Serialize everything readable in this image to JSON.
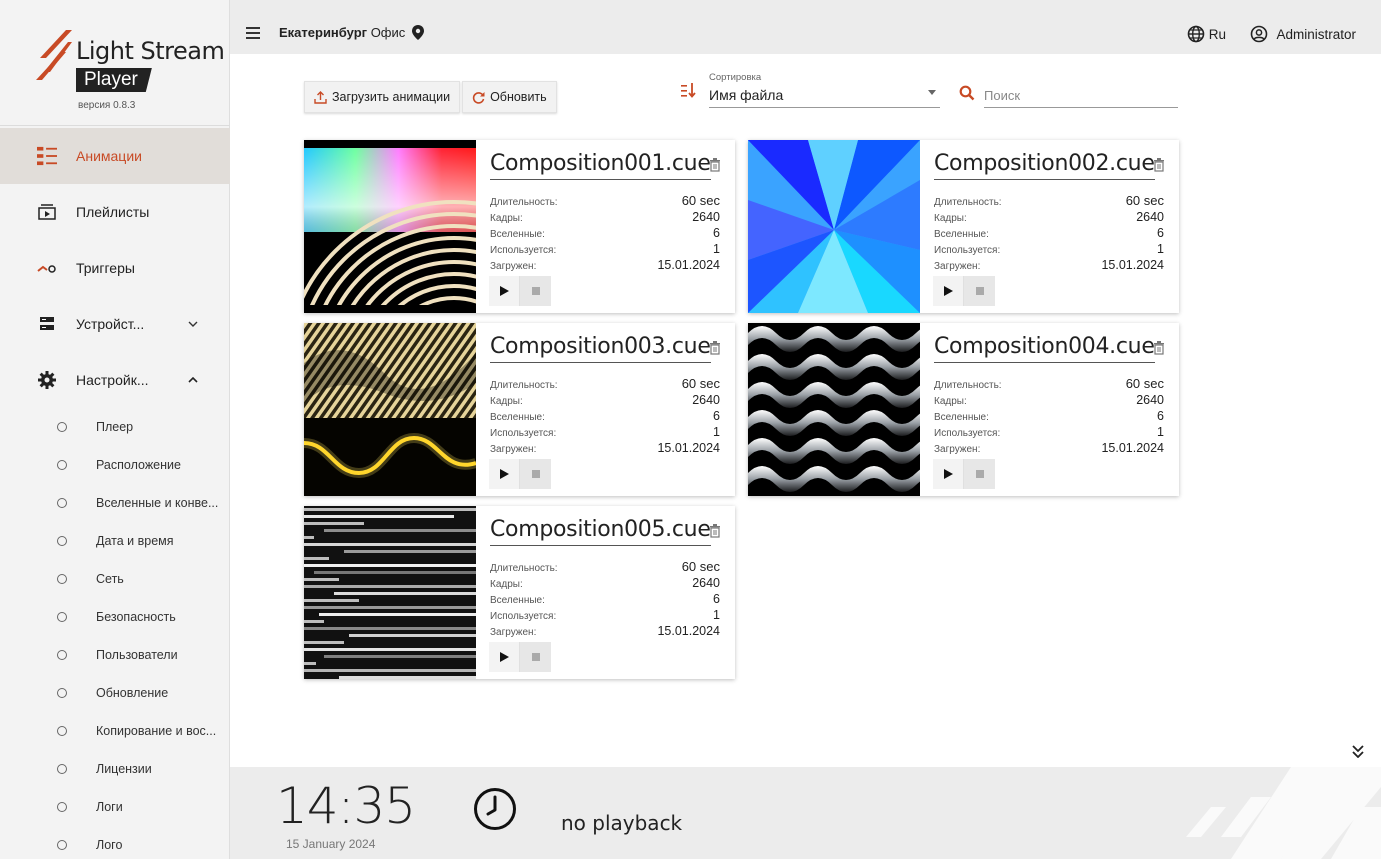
{
  "app": {
    "logo_line1": "Light Stream",
    "logo_line2": "Player",
    "version": "версия 0.8.3"
  },
  "header": {
    "city": "Екатеринбург",
    "place": "Офис",
    "language": "Ru",
    "user": "Administrator"
  },
  "sidebar": {
    "items": [
      {
        "label": "Анимации",
        "icon": "animations-icon",
        "active": true
      },
      {
        "label": "Плейлисты",
        "icon": "playlist-icon"
      },
      {
        "label": "Триггеры",
        "icon": "trigger-icon"
      },
      {
        "label": "Устройст...",
        "icon": "devices-icon",
        "chevron": "down"
      },
      {
        "label": "Настройк...",
        "icon": "gear-icon",
        "chevron": "up"
      }
    ],
    "settings_items": [
      "Плеер",
      "Расположение",
      "Вселенные и конве...",
      "Дата и время",
      "Сеть",
      "Безопасность",
      "Пользователи",
      "Обновление",
      "Копирование и вос...",
      "Лицензии",
      "Логи",
      "Лого"
    ]
  },
  "toolbar": {
    "upload_label": "Загрузить анимации",
    "refresh_label": "Обновить",
    "sort_label": "Сортировка",
    "sort_value": "Имя файла",
    "search_placeholder": "Поиск"
  },
  "card_labels": {
    "duration": "Длительность:",
    "frames": "Кадры:",
    "universes": "Вселенные:",
    "used": "Используется:",
    "uploaded": "Загружен:"
  },
  "animations": [
    {
      "name": "Composition001.cue",
      "duration": "60 sec",
      "frames": "2640",
      "universes": "6",
      "used": "1",
      "uploaded": "15.01.2024"
    },
    {
      "name": "Composition002.cue",
      "duration": "60 sec",
      "frames": "2640",
      "universes": "6",
      "used": "1",
      "uploaded": "15.01.2024"
    },
    {
      "name": "Composition003.cue",
      "duration": "60 sec",
      "frames": "2640",
      "universes": "6",
      "used": "1",
      "uploaded": "15.01.2024"
    },
    {
      "name": "Composition004.cue",
      "duration": "60 sec",
      "frames": "2640",
      "universes": "6",
      "used": "1",
      "uploaded": "15.01.2024"
    },
    {
      "name": "Composition005.cue",
      "duration": "60 sec",
      "frames": "2640",
      "universes": "6",
      "used": "1",
      "uploaded": "15.01.2024"
    }
  ],
  "footer": {
    "time": "14:35",
    "date": "15 January 2024",
    "playback": "no playback"
  },
  "colors": {
    "accent": "#c84a25",
    "active_bg": "#e1ddd9"
  }
}
